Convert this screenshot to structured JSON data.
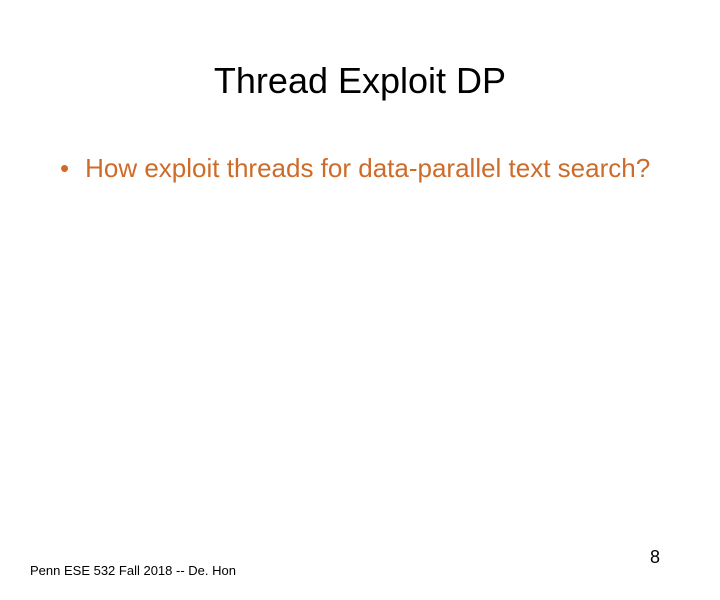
{
  "slide": {
    "title": "Thread Exploit DP",
    "bullets": [
      {
        "marker": "•",
        "text": "How exploit threads for data-parallel text search?"
      }
    ],
    "footer": "Penn ESE 532 Fall 2018 -- De. Hon",
    "page_number": "8"
  }
}
